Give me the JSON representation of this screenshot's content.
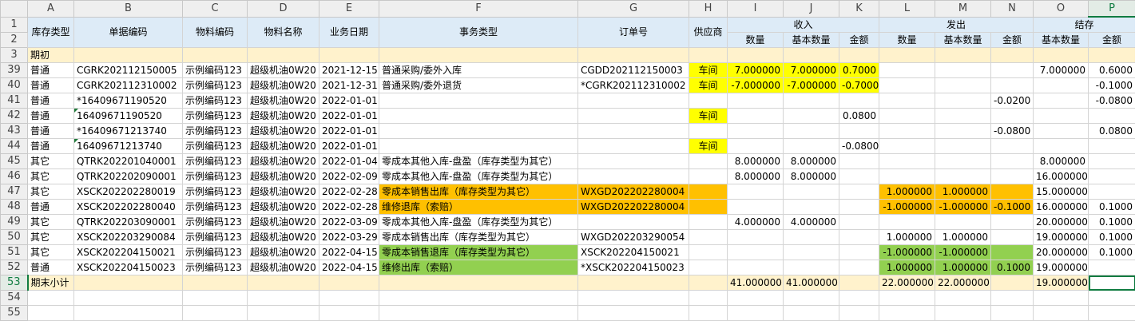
{
  "columns": [
    "A",
    "B",
    "C",
    "D",
    "E",
    "F",
    "G",
    "H",
    "I",
    "J",
    "K",
    "L",
    "M",
    "N",
    "O",
    "P"
  ],
  "selected_column": "P",
  "header": {
    "r1": {
      "A": "库存类型",
      "B": "单据编码",
      "C": "物料编码",
      "D": "物料名称",
      "E": "业务日期",
      "F": "事务类型",
      "G": "订单号",
      "H": "供应商",
      "IJK": "收入",
      "LMN": "发出",
      "OP": "结存"
    },
    "r2": {
      "I": "数量",
      "J": "基本数量",
      "K": "金额",
      "L": "数量",
      "M": "基本数量",
      "N": "金额",
      "O": "基本数量",
      "P": "金额"
    }
  },
  "opening_row": {
    "num": "3",
    "label": "期初"
  },
  "rows": [
    {
      "num": "39",
      "A": "普通",
      "B": "CGRK202112150005",
      "C": "示例编码123",
      "D": "超级机油0W20",
      "E": "2021-12-15",
      "F": "普通采购/委外入库",
      "G": "CGDD202112150003",
      "H": "车间",
      "I": "7.000000",
      "J": "7.000000",
      "K": "0.7000",
      "L": "",
      "M": "",
      "N": "",
      "O": "7.000000",
      "P": "0.6000",
      "fill": {
        "H": "y",
        "I": "y",
        "J": "y",
        "K": "y"
      },
      "tri": []
    },
    {
      "num": "40",
      "A": "普通",
      "B": "CGRK202112310002",
      "C": "示例编码123",
      "D": "超级机油0W20",
      "E": "2021-12-31",
      "F": "普通采购/委外退货",
      "G": "*CGRK202112310002",
      "H": "车间",
      "I": "-7.000000",
      "J": "-7.000000",
      "K": "-0.7000",
      "L": "",
      "M": "",
      "N": "",
      "O": "",
      "P": "-0.1000",
      "fill": {
        "H": "y",
        "I": "y",
        "J": "y",
        "K": "y"
      },
      "tri": []
    },
    {
      "num": "41",
      "A": "普通",
      "B": "*16409671190520",
      "C": "示例编码123",
      "D": "超级机油0W20",
      "E": "2022-01-01",
      "F": "",
      "G": "",
      "H": "",
      "I": "",
      "J": "",
      "K": "",
      "L": "",
      "M": "",
      "N": "-0.0200",
      "O": "",
      "P": "-0.0800",
      "fill": {},
      "tri": []
    },
    {
      "num": "42",
      "A": "普通",
      "B": "16409671190520",
      "C": "示例编码123",
      "D": "超级机油0W20",
      "E": "2022-01-01",
      "F": "",
      "G": "",
      "H": "车间",
      "I": "",
      "J": "",
      "K": "0.0800",
      "L": "",
      "M": "",
      "N": "",
      "O": "",
      "P": "",
      "fill": {
        "H": "y"
      },
      "tri": [
        "B"
      ]
    },
    {
      "num": "43",
      "A": "普通",
      "B": "*16409671213740",
      "C": "示例编码123",
      "D": "超级机油0W20",
      "E": "2022-01-01",
      "F": "",
      "G": "",
      "H": "",
      "I": "",
      "J": "",
      "K": "",
      "L": "",
      "M": "",
      "N": "-0.0800",
      "O": "",
      "P": "0.0800",
      "fill": {},
      "tri": []
    },
    {
      "num": "44",
      "A": "普通",
      "B": "16409671213740",
      "C": "示例编码123",
      "D": "超级机油0W20",
      "E": "2022-01-01",
      "F": "",
      "G": "",
      "H": "车间",
      "I": "",
      "J": "",
      "K": "-0.0800",
      "L": "",
      "M": "",
      "N": "",
      "O": "",
      "P": "",
      "fill": {
        "H": "y"
      },
      "tri": [
        "B"
      ]
    },
    {
      "num": "45",
      "A": "其它",
      "B": "QTRK202201040001",
      "C": "示例编码123",
      "D": "超级机油0W20",
      "E": "2022-01-04",
      "F": "零成本其他入库-盘盈（库存类型为其它）",
      "G": "",
      "H": "",
      "I": "8.000000",
      "J": "8.000000",
      "K": "",
      "L": "",
      "M": "",
      "N": "",
      "O": "8.000000",
      "P": "",
      "fill": {},
      "tri": []
    },
    {
      "num": "46",
      "A": "其它",
      "B": "QTRK202202090001",
      "C": "示例编码123",
      "D": "超级机油0W20",
      "E": "2022-02-09",
      "F": "零成本其他入库-盘盈（库存类型为其它）",
      "G": "",
      "H": "",
      "I": "8.000000",
      "J": "8.000000",
      "K": "",
      "L": "",
      "M": "",
      "N": "",
      "O": "16.000000",
      "P": "",
      "fill": {},
      "tri": []
    },
    {
      "num": "47",
      "A": "其它",
      "B": "XSCK202202280019",
      "C": "示例编码123",
      "D": "超级机油0W20",
      "E": "2022-02-28",
      "F": "零成本销售出库（库存类型为其它）",
      "G": "WXGD202202280004",
      "H": "",
      "I": "",
      "J": "",
      "K": "",
      "L": "1.000000",
      "M": "1.000000",
      "N": "",
      "O": "15.000000",
      "P": "",
      "fill": {
        "F": "o",
        "G": "o",
        "H": "o",
        "L": "o",
        "M": "o",
        "N": "o"
      },
      "tri": []
    },
    {
      "num": "48",
      "A": "普通",
      "B": "XSCK202202280040",
      "C": "示例编码123",
      "D": "超级机油0W20",
      "E": "2022-02-28",
      "F": "维修退库（索赔）",
      "G": "WXGD202202280004",
      "H": "",
      "I": "",
      "J": "",
      "K": "",
      "L": "-1.000000",
      "M": "-1.000000",
      "N": "-0.1000",
      "O": "16.000000",
      "P": "0.1000",
      "fill": {
        "F": "o",
        "G": "o",
        "H": "o",
        "L": "o",
        "M": "o",
        "N": "o"
      },
      "tri": []
    },
    {
      "num": "49",
      "A": "其它",
      "B": "QTRK202203090001",
      "C": "示例编码123",
      "D": "超级机油0W20",
      "E": "2022-03-09",
      "F": "零成本其他入库-盘盈（库存类型为其它）",
      "G": "",
      "H": "",
      "I": "4.000000",
      "J": "4.000000",
      "K": "",
      "L": "",
      "M": "",
      "N": "",
      "O": "20.000000",
      "P": "0.1000",
      "fill": {},
      "tri": []
    },
    {
      "num": "50",
      "A": "其它",
      "B": "XSCK202203290084",
      "C": "示例编码123",
      "D": "超级机油0W20",
      "E": "2022-03-29",
      "F": "零成本销售出库（库存类型为其它）",
      "G": "WXGD202203290054",
      "H": "",
      "I": "",
      "J": "",
      "K": "",
      "L": "1.000000",
      "M": "1.000000",
      "N": "",
      "O": "19.000000",
      "P": "0.1000",
      "fill": {},
      "tri": []
    },
    {
      "num": "51",
      "A": "其它",
      "B": "XSCK202204150021",
      "C": "示例编码123",
      "D": "超级机油0W20",
      "E": "2022-04-15",
      "F": "零成本销售退库（库存类型为其它）",
      "G": "XSCK202204150021",
      "H": "",
      "I": "",
      "J": "",
      "K": "",
      "L": "-1.000000",
      "M": "-1.000000",
      "N": "",
      "O": "20.000000",
      "P": "0.1000",
      "fill": {
        "F": "g",
        "L": "g",
        "M": "g",
        "N": "g"
      },
      "tri": []
    },
    {
      "num": "52",
      "A": "普通",
      "B": "XSCK202204150023",
      "C": "示例编码123",
      "D": "超级机油0W20",
      "E": "2022-04-15",
      "F": "维修出库（索赔）",
      "G": "*XSCK202204150023",
      "H": "",
      "I": "",
      "J": "",
      "K": "",
      "L": "1.000000",
      "M": "1.000000",
      "N": "0.1000",
      "O": "19.000000",
      "P": "",
      "fill": {
        "F": "g",
        "L": "g",
        "M": "g",
        "N": "g"
      },
      "tri": []
    }
  ],
  "closing_row": {
    "num": "53",
    "label": "期末小计",
    "I": "41.000000",
    "J": "41.000000",
    "L": "22.000000",
    "M": "22.000000",
    "O": "19.000000"
  },
  "extra_rows": [
    "54",
    "55"
  ],
  "active_cell": "P53"
}
